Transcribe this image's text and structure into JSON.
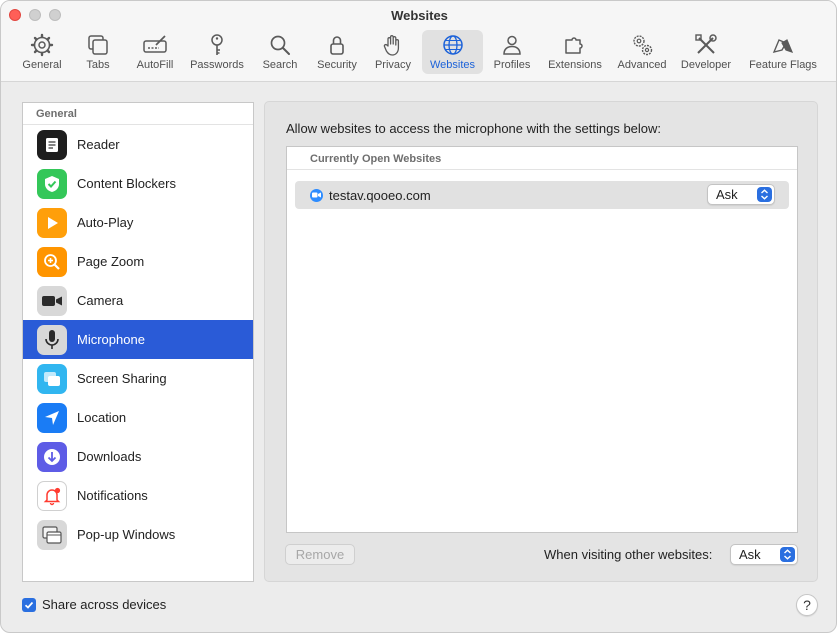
{
  "window": {
    "title": "Websites"
  },
  "toolbar": {
    "tabs": [
      {
        "label": "General",
        "icon": "gear-icon"
      },
      {
        "label": "Tabs",
        "icon": "tabs-icon"
      },
      {
        "label": "AutoFill",
        "icon": "autofill-icon"
      },
      {
        "label": "Passwords",
        "icon": "key-icon"
      },
      {
        "label": "Search",
        "icon": "search-icon"
      },
      {
        "label": "Security",
        "icon": "lock-icon"
      },
      {
        "label": "Privacy",
        "icon": "hand-icon"
      },
      {
        "label": "Websites",
        "icon": "globe-icon",
        "selected": true
      },
      {
        "label": "Profiles",
        "icon": "person-icon"
      },
      {
        "label": "Extensions",
        "icon": "puzzle-icon"
      },
      {
        "label": "Advanced",
        "icon": "gears-icon"
      },
      {
        "label": "Developer",
        "icon": "tools-icon"
      },
      {
        "label": "Feature Flags",
        "icon": "flags-icon"
      }
    ]
  },
  "sidebar": {
    "header": "General",
    "items": [
      {
        "label": "Reader",
        "icon": "reader-icon"
      },
      {
        "label": "Content Blockers",
        "icon": "shield-check-icon"
      },
      {
        "label": "Auto-Play",
        "icon": "play-icon"
      },
      {
        "label": "Page Zoom",
        "icon": "zoom-icon"
      },
      {
        "label": "Camera",
        "icon": "camera-icon"
      },
      {
        "label": "Microphone",
        "icon": "microphone-icon",
        "selected": true
      },
      {
        "label": "Screen Sharing",
        "icon": "screen-sharing-icon"
      },
      {
        "label": "Location",
        "icon": "location-arrow-icon"
      },
      {
        "label": "Downloads",
        "icon": "download-icon"
      },
      {
        "label": "Notifications",
        "icon": "bell-icon"
      },
      {
        "label": "Pop-up Windows",
        "icon": "popup-windows-icon"
      }
    ]
  },
  "main": {
    "description": "Allow websites to access the microphone with the settings below:",
    "list_header": "Currently Open Websites",
    "sites": [
      {
        "name": "testav.qooeo.com",
        "setting": "Ask"
      }
    ],
    "remove_label": "Remove",
    "other_websites_label": "When visiting other websites:",
    "other_websites_value": "Ask"
  },
  "footer": {
    "share_label": "Share across devices",
    "share_checked": true,
    "help_label": "?"
  },
  "colors": {
    "accent": "#2a5bd7",
    "selected_tab_label": "#1c62d9",
    "close_button": "#ff5f57"
  }
}
